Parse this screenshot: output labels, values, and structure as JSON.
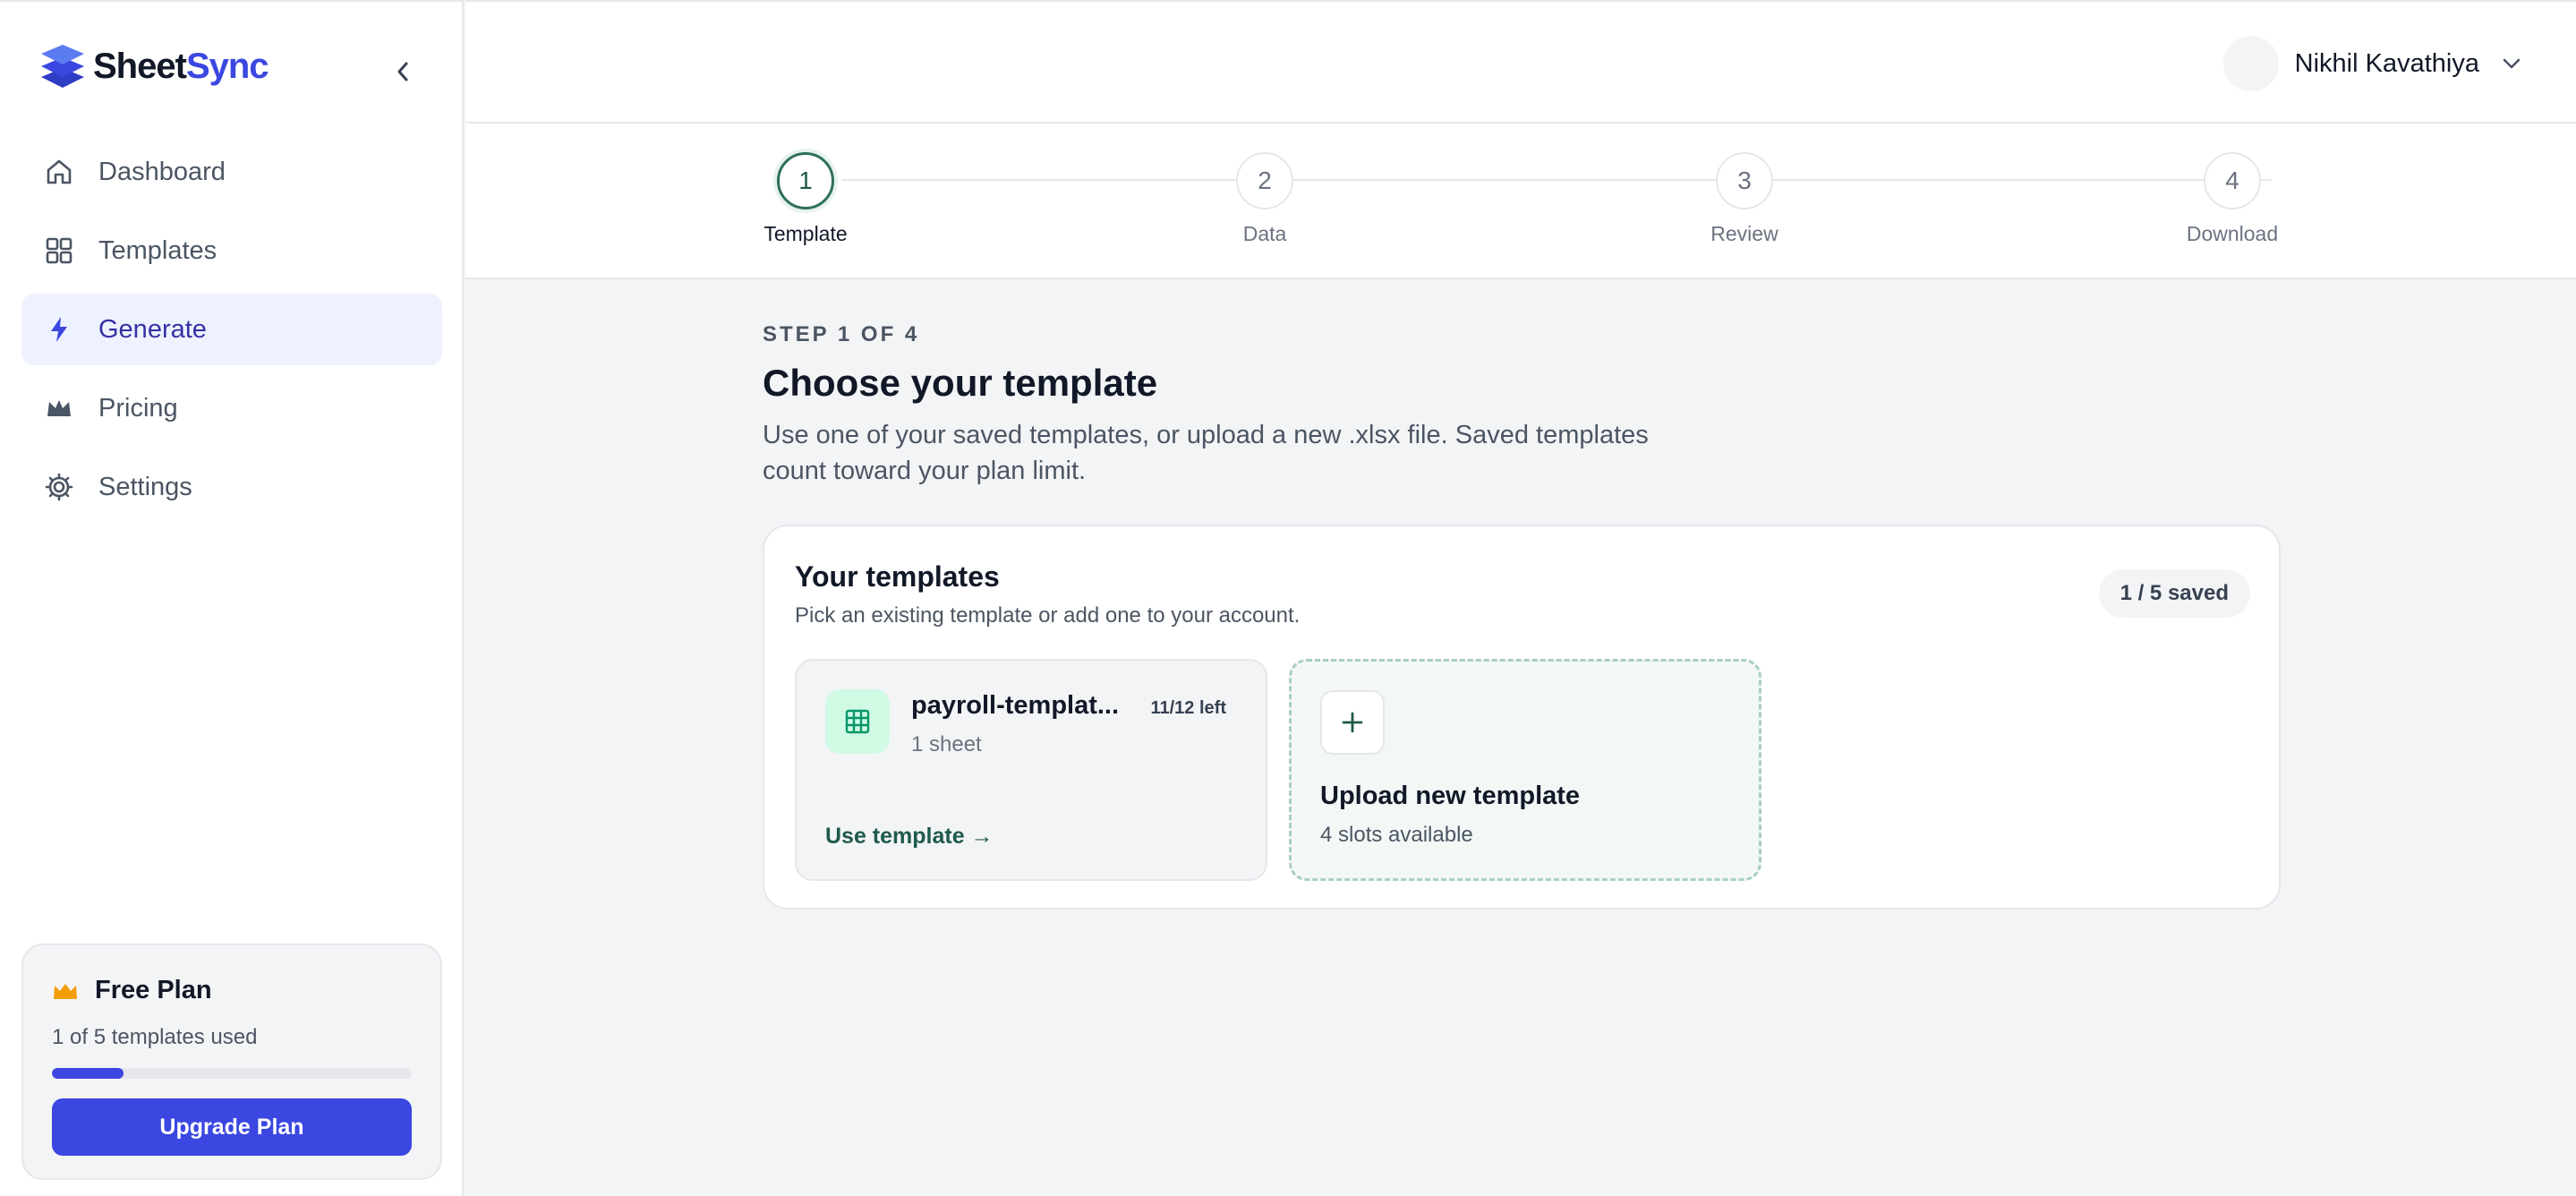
{
  "brand": {
    "name_part1": "Sheet",
    "name_part2": "Sync",
    "accent": "#3b47e0"
  },
  "sidebar": {
    "items": [
      {
        "label": "Dashboard",
        "icon": "home-icon"
      },
      {
        "label": "Templates",
        "icon": "grid-icon"
      },
      {
        "label": "Generate",
        "icon": "bolt-icon",
        "active": true
      },
      {
        "label": "Pricing",
        "icon": "crown-icon"
      },
      {
        "label": "Settings",
        "icon": "gear-icon"
      }
    ]
  },
  "plan": {
    "title": "Free Plan",
    "usage_text": "1 of 5 templates used",
    "usage_fraction": 0.2,
    "upgrade_label": "Upgrade Plan"
  },
  "user": {
    "name": "Nikhil Kavathiya"
  },
  "stepper": {
    "steps": [
      {
        "number": "1",
        "label": "Template",
        "active": true
      },
      {
        "number": "2",
        "label": "Data"
      },
      {
        "number": "3",
        "label": "Review"
      },
      {
        "number": "4",
        "label": "Download"
      }
    ]
  },
  "main": {
    "eyebrow": "STEP 1 OF 4",
    "title": "Choose your template",
    "description": "Use one of your saved templates, or upload a new .xlsx file. Saved templates count toward your plan limit."
  },
  "templates_panel": {
    "title": "Your templates",
    "subtitle": "Pick an existing template or add one to your account.",
    "badge": "1 / 5 saved",
    "template": {
      "name": "payroll-templat...",
      "remaining": "11/12 left",
      "sheets": "1 sheet",
      "use_label": "Use template →"
    },
    "upload": {
      "title": "Upload new template",
      "subtitle": "4 slots available"
    }
  }
}
